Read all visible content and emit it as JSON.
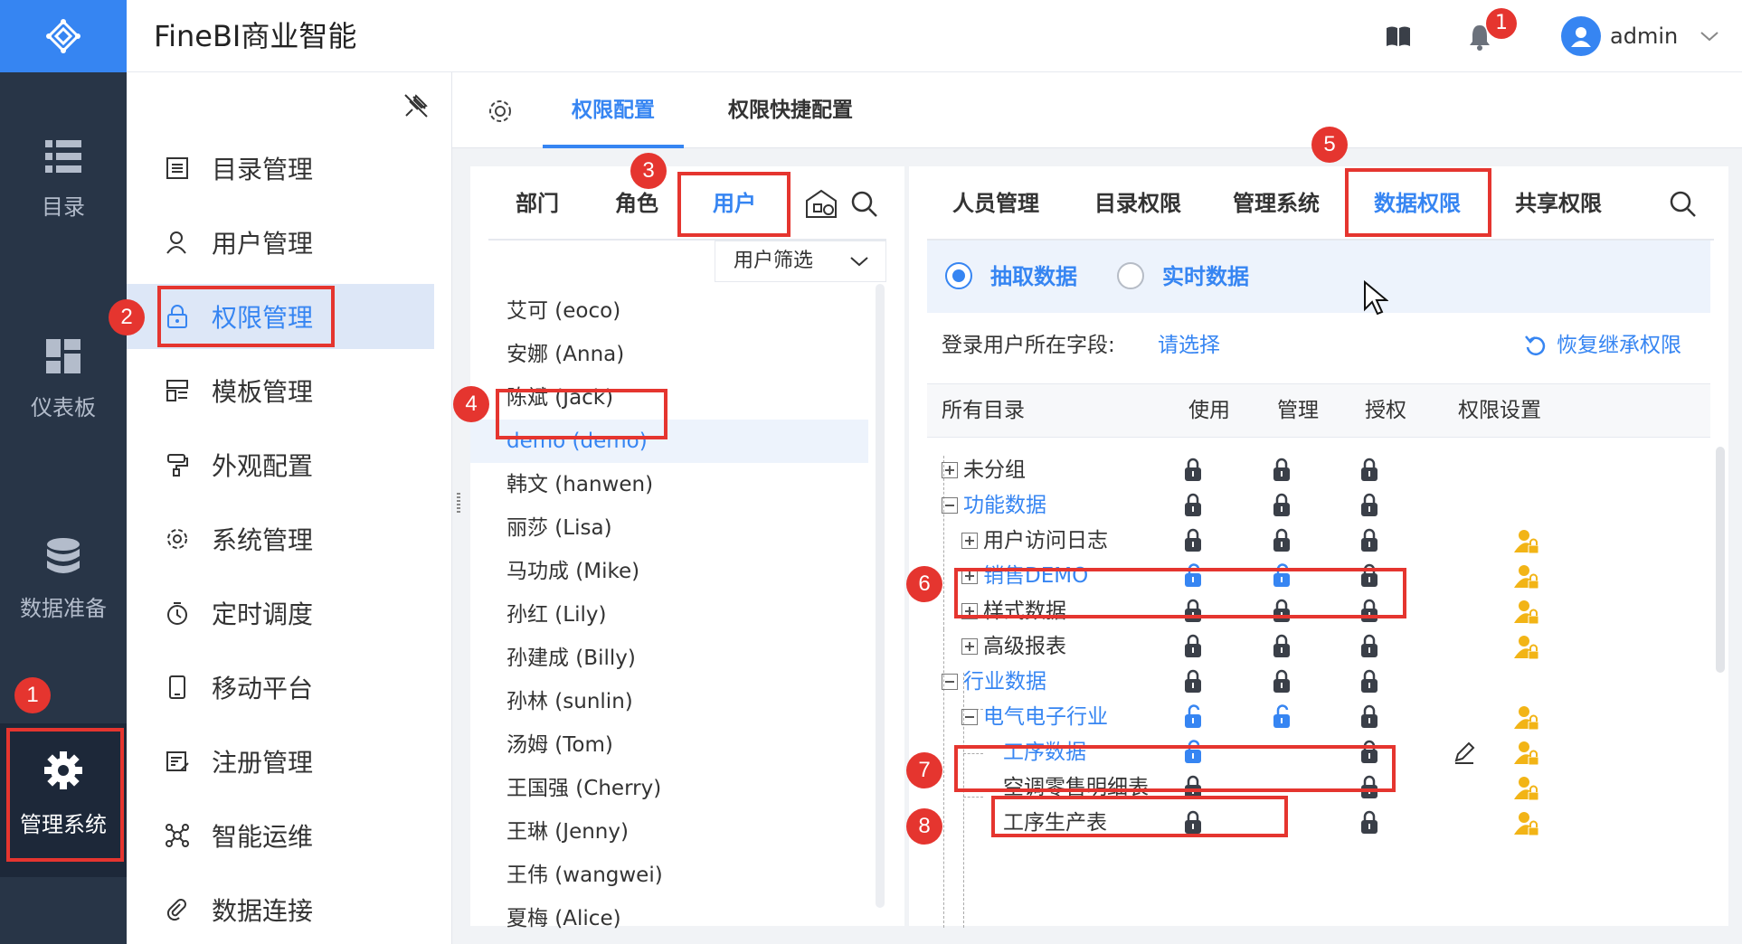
{
  "header": {
    "app_title": "FineBI商业智能",
    "notification_count": "1",
    "user_name": "admin"
  },
  "leftbar": {
    "items": [
      {
        "label": "目录",
        "icon": "list-icon"
      },
      {
        "label": "仪表板",
        "icon": "dashboard-icon"
      },
      {
        "label": "数据准备",
        "icon": "database-icon"
      },
      {
        "label": "管理系统",
        "icon": "gear-icon"
      }
    ]
  },
  "sidebar": {
    "items": [
      {
        "label": "目录管理",
        "icon": "catalog-icon"
      },
      {
        "label": "用户管理",
        "icon": "user-icon"
      },
      {
        "label": "权限管理",
        "icon": "lock-icon"
      },
      {
        "label": "模板管理",
        "icon": "template-icon"
      },
      {
        "label": "外观配置",
        "icon": "brush-icon"
      },
      {
        "label": "系统管理",
        "icon": "settings-icon"
      },
      {
        "label": "定时调度",
        "icon": "timer-icon"
      },
      {
        "label": "移动平台",
        "icon": "mobile-icon"
      },
      {
        "label": "注册管理",
        "icon": "register-icon"
      },
      {
        "label": "智能运维",
        "icon": "ops-icon"
      },
      {
        "label": "数据连接",
        "icon": "link-icon"
      }
    ],
    "active": "权限管理"
  },
  "top_tabs": [
    {
      "label": "权限配置"
    },
    {
      "label": "权限快捷配置"
    }
  ],
  "user_panel": {
    "tabs": [
      {
        "label": "部门"
      },
      {
        "label": "角色"
      },
      {
        "label": "用户"
      }
    ],
    "filter_label": "用户筛选",
    "users": [
      "艾可 (eoco)",
      "安娜 (Anna)",
      "陈斌 (Jack)",
      "demo (demo)",
      "韩文 (hanwen)",
      "丽莎 (Lisa)",
      "马功成 (Mike)",
      "孙红 (Lily)",
      "孙建成 (Billy)",
      "孙林 (sunlin)",
      "汤姆 (Tom)",
      "王国强 (Cherry)",
      "王琳 (Jenny)",
      "王伟 (wangwei)",
      "夏梅 (Alice)"
    ],
    "selected": "demo (demo)"
  },
  "perm_panel": {
    "tabs": [
      {
        "label": "人员管理"
      },
      {
        "label": "目录权限"
      },
      {
        "label": "管理系统"
      },
      {
        "label": "数据权限"
      },
      {
        "label": "共享权限"
      }
    ],
    "radio": {
      "extract": "抽取数据",
      "realtime": "实时数据",
      "selected": "抽取数据"
    },
    "field_label": "登录用户所在字段:",
    "field_select": "请选择",
    "restore_label": "恢复继承权限",
    "columns": [
      "所有目录",
      "使用",
      "管理",
      "授权",
      "权限设置"
    ],
    "rows": [
      {
        "label": "未分组",
        "toggle": "plus",
        "use": "locked",
        "manage": "locked",
        "grant": "locked",
        "setting": false,
        "edit": false,
        "blue": false
      },
      {
        "label": "功能数据",
        "toggle": "minus",
        "use": "locked",
        "manage": "locked",
        "grant": "locked",
        "setting": false,
        "edit": false,
        "blue": true
      },
      {
        "label": "用户访问日志",
        "toggle": "plus",
        "use": "locked",
        "manage": "locked",
        "grant": "locked",
        "setting": true,
        "edit": false,
        "blue": false
      },
      {
        "label": "销售DEMO",
        "toggle": "plus",
        "use": "unlocked",
        "manage": "unlocked",
        "grant": "locked",
        "setting": true,
        "edit": false,
        "blue": true
      },
      {
        "label": "样式数据",
        "toggle": "plus",
        "use": "locked",
        "manage": "locked",
        "grant": "locked",
        "setting": true,
        "edit": false,
        "blue": false
      },
      {
        "label": "高级报表",
        "toggle": "plus",
        "use": "locked",
        "manage": "locked",
        "grant": "locked",
        "setting": true,
        "edit": false,
        "blue": false
      },
      {
        "label": "行业数据",
        "toggle": "minus",
        "use": "locked",
        "manage": "locked",
        "grant": "locked",
        "setting": false,
        "edit": false,
        "blue": true
      },
      {
        "label": "电气电子行业",
        "toggle": "minus",
        "use": "unlocked",
        "manage": "unlocked",
        "grant": "locked",
        "setting": true,
        "edit": false,
        "blue": true
      },
      {
        "label": "工序数据",
        "toggle": "none",
        "use": "unlocked",
        "manage": "none",
        "grant": "locked",
        "setting": true,
        "edit": true,
        "blue": true
      },
      {
        "label": "空调零售明细表",
        "toggle": "none",
        "use": "locked",
        "manage": "none",
        "grant": "locked",
        "setting": true,
        "edit": false,
        "blue": false
      },
      {
        "label": "工序生产表",
        "toggle": "none",
        "use": "locked",
        "manage": "none",
        "grant": "locked",
        "setting": true,
        "edit": false,
        "blue": false
      }
    ]
  },
  "annotations": [
    "1",
    "2",
    "3",
    "4",
    "5",
    "6",
    "7",
    "8"
  ],
  "colors": {
    "accent": "#3685f2",
    "sidebar_dark": "#283547",
    "annotation_red": "#e5352f",
    "setting_gold": "#f2b416"
  }
}
